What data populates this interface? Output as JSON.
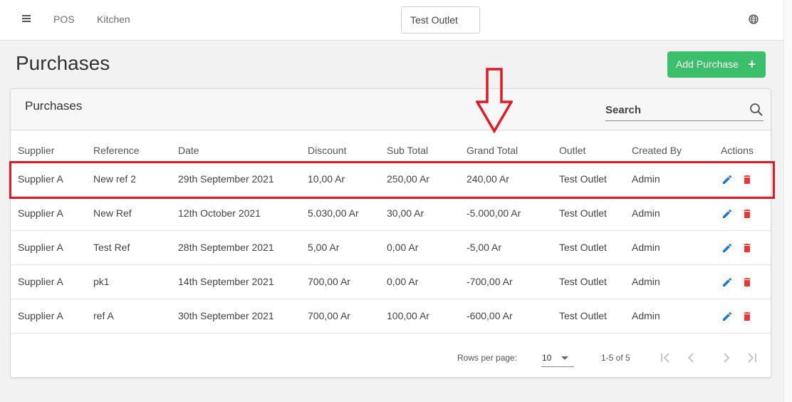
{
  "topbar": {
    "nav": [
      "POS",
      "Kitchen"
    ],
    "outlet": "Test Outlet"
  },
  "page": {
    "title": "Purchases",
    "add_button": "Add Purchase"
  },
  "card": {
    "title": "Purchases",
    "search_placeholder": "Search"
  },
  "table": {
    "headers": [
      "Supplier",
      "Reference",
      "Date",
      "Discount",
      "Sub Total",
      "Grand Total",
      "Outlet",
      "Created By",
      "Actions"
    ],
    "rows": [
      [
        "Supplier A",
        "New ref 2",
        "29th September 2021",
        "10,00 Ar",
        "250,00 Ar",
        "240,00 Ar",
        "Test Outlet",
        "Admin"
      ],
      [
        "Supplier A",
        "New Ref",
        "12th October 2021",
        "5.030,00 Ar",
        "30,00 Ar",
        "-5.000,00 Ar",
        "Test Outlet",
        "Admin"
      ],
      [
        "Supplier A",
        "Test Ref",
        "28th September 2021",
        "5,00 Ar",
        "0,00 Ar",
        "-5,00 Ar",
        "Test Outlet",
        "Admin"
      ],
      [
        "Supplier A",
        "pk1",
        "14th September 2021",
        "700,00 Ar",
        "0,00 Ar",
        "-700,00 Ar",
        "Test Outlet",
        "Admin"
      ],
      [
        "Supplier A",
        "ref A",
        "30th September 2021",
        "700,00 Ar",
        "100,00 Ar",
        "-600,00 Ar",
        "Test Outlet",
        "Admin"
      ]
    ]
  },
  "pagination": {
    "rows_per_page_label": "Rows per page:",
    "rows_per_page": "10",
    "range": "1-5 of 5"
  },
  "colors": {
    "accent_green": "#3cbf6b",
    "edit_blue": "#1976d2",
    "delete_red": "#e53935",
    "annotation_red": "#e01a22"
  },
  "icons": [
    "menu-icon",
    "globe-icon",
    "plus-icon",
    "search-icon",
    "edit-icon",
    "delete-icon",
    "first-page-icon",
    "prev-page-icon",
    "next-page-icon",
    "last-page-icon"
  ]
}
